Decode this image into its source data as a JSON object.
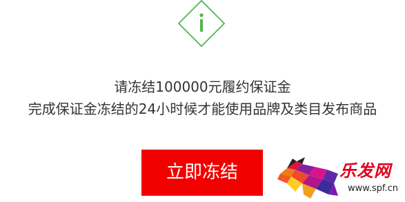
{
  "dialog": {
    "icon": "info-diamond-icon",
    "icon_color": "#4fb84b",
    "message_line_1": "请冻结100000元履约保证金",
    "message_line_2": "完成保证金冻结的24小时候才能使用品牌及类目发布商品",
    "button_label": "立即冻结",
    "button_color": "#f20000"
  },
  "watermark": {
    "logo_text": "乐发网",
    "url": "www.spf.cn",
    "icon": "bull-logo-icon"
  }
}
